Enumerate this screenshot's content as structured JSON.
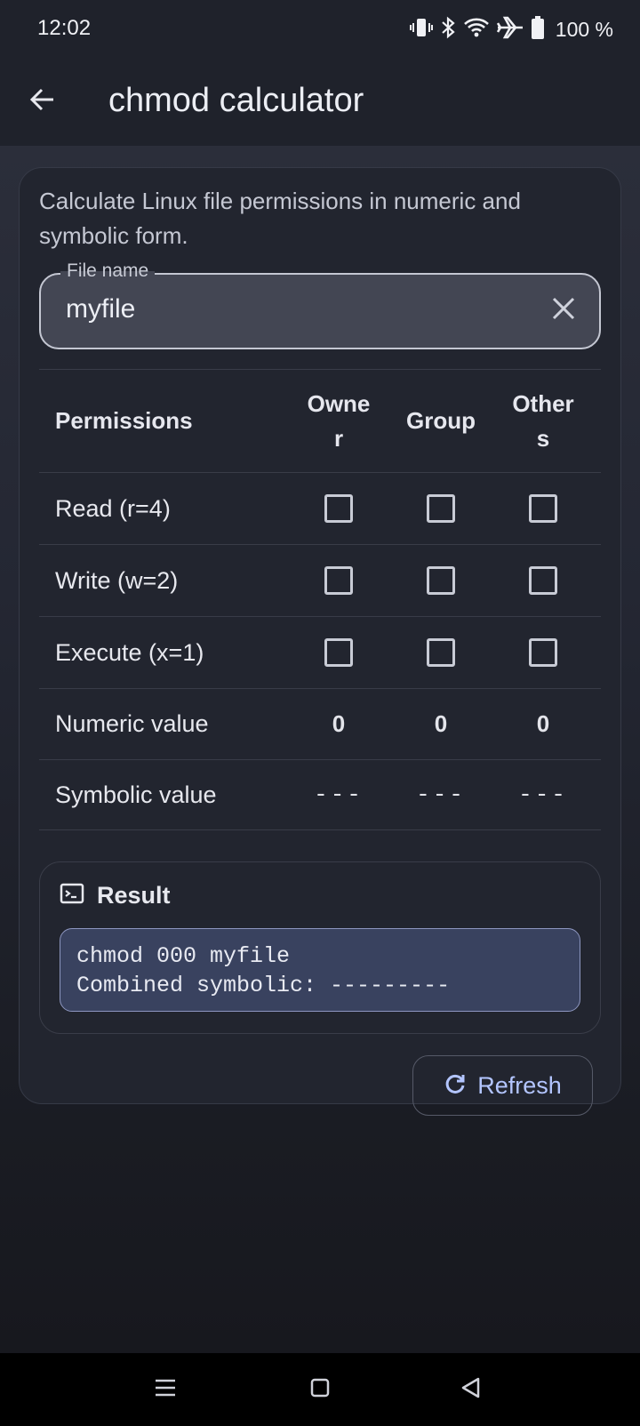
{
  "status_bar": {
    "time": "12:02",
    "battery": "100 %",
    "icons": [
      "vibrate-icon",
      "bluetooth-icon",
      "wifi-icon",
      "airplane-icon",
      "battery-icon"
    ]
  },
  "app_bar": {
    "title": "chmod calculator",
    "back_icon": "arrow-back-icon"
  },
  "card": {
    "description": "Calculate Linux file permissions in numeric and symbolic form.",
    "file_field": {
      "label": "File name",
      "value": "myfile",
      "clear_icon": "close-icon"
    },
    "table": {
      "header": {
        "label": "Permissions",
        "columns": [
          "Owner",
          "Group",
          "Others"
        ]
      },
      "rows": [
        {
          "label": "Read (r=4)",
          "checked": [
            false,
            false,
            false
          ]
        },
        {
          "label": "Write (w=2)",
          "checked": [
            false,
            false,
            false
          ]
        },
        {
          "label": "Execute (x=1)",
          "checked": [
            false,
            false,
            false
          ]
        }
      ],
      "numeric": {
        "label": "Numeric value",
        "values": [
          "0",
          "0",
          "0"
        ]
      },
      "symbolic": {
        "label": "Symbolic value",
        "values": [
          "---",
          "---",
          "---"
        ]
      }
    },
    "result": {
      "title": "Result",
      "icon": "terminal-icon",
      "lines": [
        "chmod 000 myfile",
        "Combined symbolic: ---------"
      ]
    },
    "refresh": {
      "label": "Refresh",
      "icon": "refresh-icon"
    }
  },
  "colors": {
    "background": "#181a21",
    "card": "#22252f",
    "accent": "#b3c5ff",
    "result_box": "#39425f"
  },
  "nav_bar": {
    "buttons": [
      "menu-icon",
      "home-icon",
      "back-triangle-icon"
    ]
  }
}
